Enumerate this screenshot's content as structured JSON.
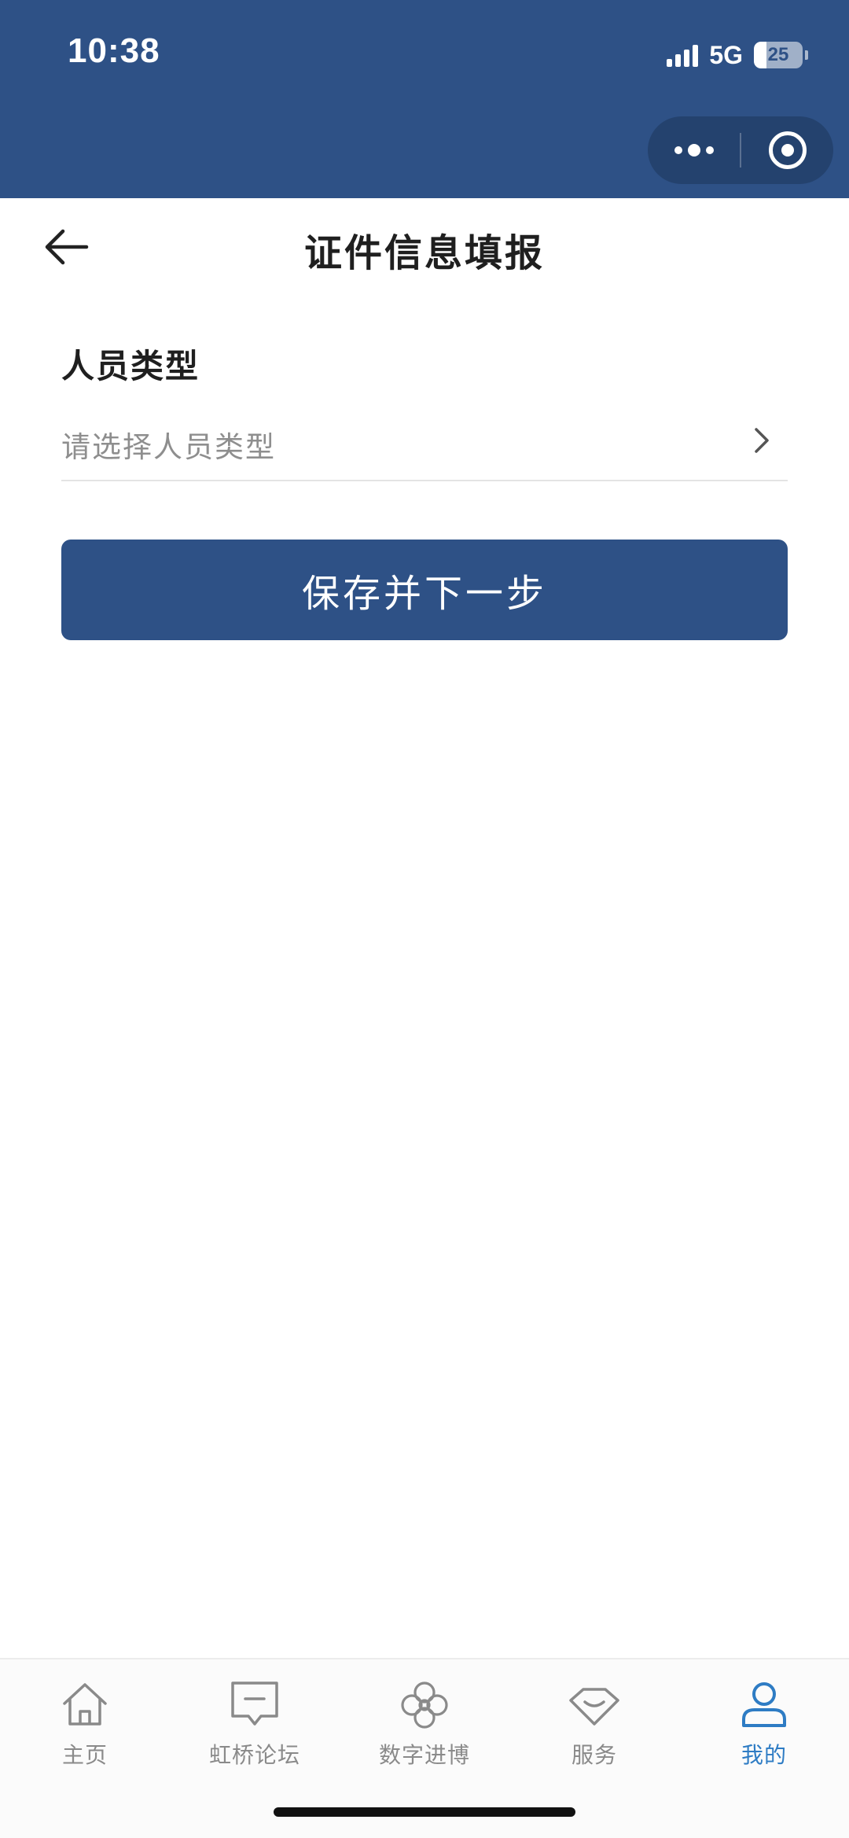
{
  "status_bar": {
    "time": "10:38",
    "network": "5G",
    "battery_level": "25",
    "battery_fraction": 0.25
  },
  "capsule": {
    "more_icon": "more-dots-icon",
    "close_icon": "target-circle-icon"
  },
  "nav": {
    "title": "证件信息填报",
    "back_icon": "arrow-left-icon"
  },
  "form": {
    "person_type": {
      "label": "人员类型",
      "placeholder": "请选择人员类型",
      "value": ""
    },
    "submit_label": "保存并下一步"
  },
  "tabbar": {
    "items": [
      {
        "label": "主页",
        "icon": "home-icon",
        "active": false
      },
      {
        "label": "虹桥论坛",
        "icon": "message-square-icon",
        "active": false
      },
      {
        "label": "数字进博",
        "icon": "flower-icon",
        "active": false
      },
      {
        "label": "服务",
        "icon": "diamond-icon",
        "active": false
      },
      {
        "label": "我的",
        "icon": "user-icon",
        "active": true
      }
    ]
  },
  "colors": {
    "primary": "#2e5186",
    "tab_active": "#2e7cc4",
    "tab_inactive": "#8a8a8a",
    "placeholder": "#8e8e8e"
  }
}
